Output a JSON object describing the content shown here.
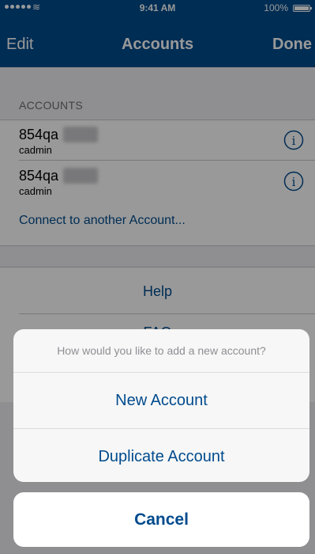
{
  "status_bar": {
    "time": "9:41 AM",
    "battery_percent": "100%",
    "wifi_glyph": "≋"
  },
  "nav": {
    "left_label": "Edit",
    "title": "Accounts",
    "right_label": "Done"
  },
  "accounts_section": {
    "header": "ACCOUNTS",
    "items": [
      {
        "name": "854qa",
        "user": "cadmin",
        "icon": "info-icon"
      },
      {
        "name": "854qa",
        "user": "cadmin",
        "icon": "info-icon"
      }
    ],
    "connect_label": "Connect to another Account..."
  },
  "links": {
    "help": "Help",
    "faq": "FAQ"
  },
  "action_sheet": {
    "message": "How would you like to add a new account?",
    "options": [
      "New Account",
      "Duplicate Account"
    ],
    "cancel": "Cancel"
  },
  "colors": {
    "brand_blue": "#004b8d",
    "background": "#efeff4",
    "separator": "#c8c7cc"
  }
}
